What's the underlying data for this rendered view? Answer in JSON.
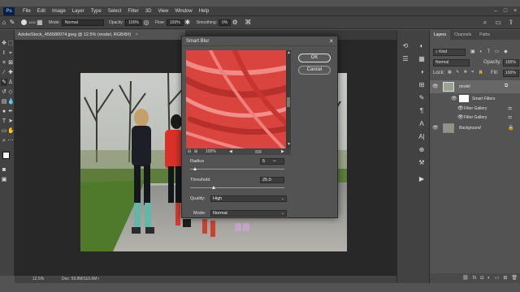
{
  "menu": {
    "logo": "Ps",
    "items": [
      "File",
      "Edit",
      "Image",
      "Layer",
      "Type",
      "Select",
      "Filter",
      "3D",
      "View",
      "Window",
      "Help"
    ]
  },
  "options": {
    "brush_size": "1200",
    "mode_label": "Mode:",
    "mode_value": "Normal",
    "opacity_label": "Opacity:",
    "opacity_value": "100%",
    "flow_label": "Flow:",
    "flow_value": "100%",
    "smoothing_label": "Smoothing:",
    "smoothing_value": "0%"
  },
  "document": {
    "tab_title": "AdobeStock_456580074.jpeg @ 12.5% (model, RGB/8#)",
    "tab_close": "×",
    "zoom": "12.5%",
    "doc_size": "Doc: 59.8M/110.6M"
  },
  "dialog": {
    "title": "Smart Blur",
    "ok_label": "OK",
    "cancel_label": "Cancel",
    "zoom_value": "100%",
    "radius_label": "Radius",
    "radius_value": "5",
    "radius_fraction": 0.05,
    "threshold_label": "Threshold",
    "threshold_value": "25.0",
    "threshold_fraction": 0.25,
    "quality_label": "Quality:",
    "quality_value": "High",
    "mode_label": "Mode:",
    "mode_value": "Normal"
  },
  "layers_panel": {
    "tabs": [
      "Layers",
      "Channels",
      "Paths"
    ],
    "filter_kind": "Kind",
    "blend_mode": "Normal",
    "opacity_label": "Opacity:",
    "opacity_value": "100%",
    "lock_label": "Lock:",
    "fill_label": "Fill:",
    "fill_value": "100%",
    "layers": [
      {
        "name": "model"
      },
      {
        "name": "Smart Filters"
      },
      {
        "name": "Filter Gallery"
      },
      {
        "name": "Filter Gallery"
      },
      {
        "name": "Background"
      }
    ]
  },
  "colors": {
    "accent_red": "#d9443f",
    "panel_bg": "#535353",
    "canvas_bg": "#282828"
  }
}
